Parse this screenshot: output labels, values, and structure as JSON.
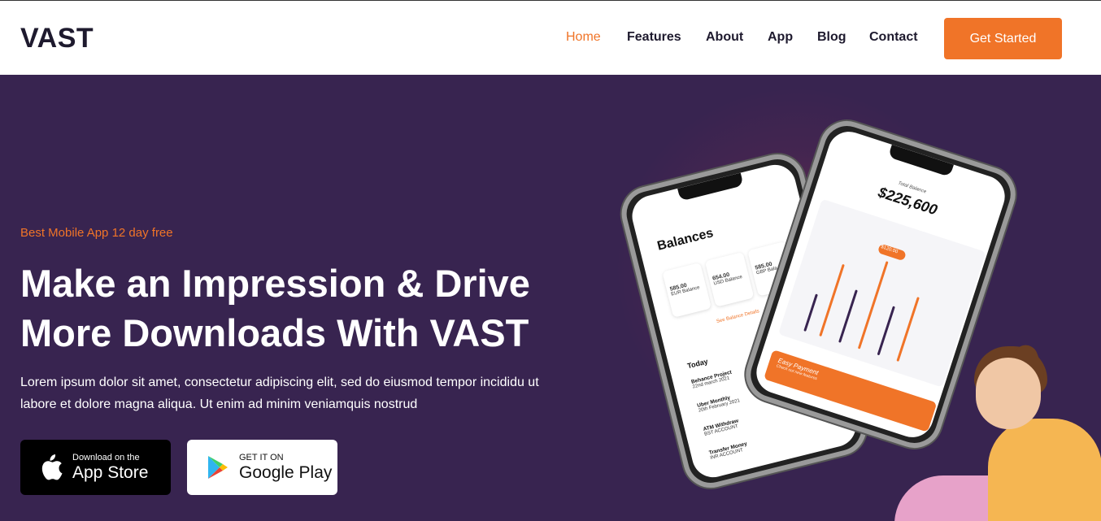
{
  "header": {
    "logo": "VAST",
    "nav": [
      {
        "label": "Home",
        "active": true
      },
      {
        "label": "Features",
        "active": false
      },
      {
        "label": "About",
        "active": false
      },
      {
        "label": "App",
        "active": false
      },
      {
        "label": "Blog",
        "active": false
      },
      {
        "label": "Contact",
        "active": false
      }
    ],
    "cta": "Get Started"
  },
  "hero": {
    "tagline": "Best Mobile App 12 day free",
    "headline": "Make an Impression & Drive More Downloads With VAST",
    "description": "Lorem ipsum dolor sit amet, consectetur adipiscing elit, sed do eiusmod tempor incididu ut labore et dolore magna aliqua. Ut enim ad minim veniamquis nostrud",
    "app_store": {
      "small": "Download on the",
      "big": "App Store"
    },
    "google_play": {
      "small": "GET IT ON",
      "big": "Google Play"
    }
  },
  "phone_left": {
    "title": "Balances",
    "cards": [
      {
        "value": "585.00",
        "label": "EUR Balance"
      },
      {
        "value": "654.00",
        "label": "USD Balance"
      },
      {
        "value": "585.00",
        "label": "GBP Bala"
      }
    ],
    "see_balance": "See Balance Details",
    "today": "Today",
    "transactions": [
      {
        "name": "Behance Project",
        "sub": "22nd march 2021"
      },
      {
        "name": "Uber Monthly",
        "sub": "20th February 2021"
      },
      {
        "name": "ATM Withdraw",
        "sub": "BST ACCOUNT"
      },
      {
        "name": "Transfer Money",
        "sub": "INR ACCOUNT"
      }
    ]
  },
  "phone_right": {
    "total_label": "Total Balance",
    "total_value": "$225,600",
    "chart_badge": "$120.00",
    "payment_title": "Easy Payment",
    "payment_sub": "Check out new features"
  },
  "colors": {
    "accent": "#f07428",
    "hero_bg": "#382450",
    "text_dark": "#1e1a2e"
  }
}
